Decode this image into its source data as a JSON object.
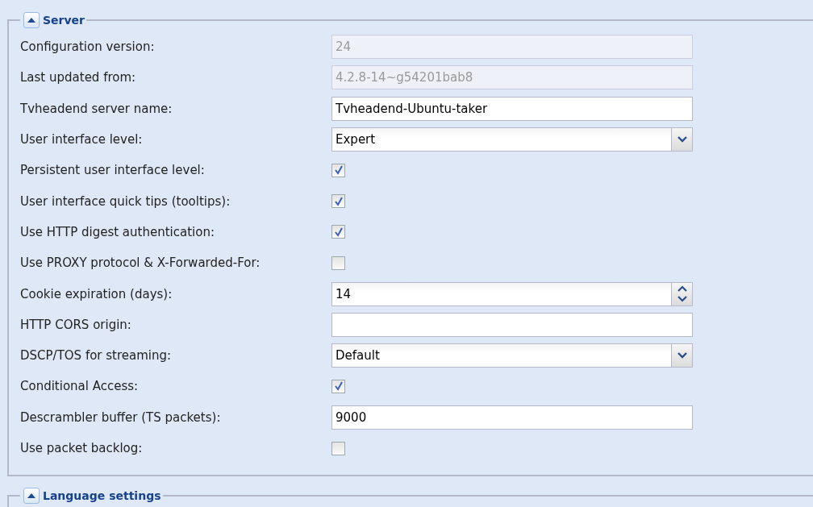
{
  "sections": [
    {
      "title": "Server",
      "expanded": true,
      "fields": [
        {
          "label": "Configuration version:",
          "kind": "text",
          "value": "24",
          "disabled": true
        },
        {
          "label": "Last updated from:",
          "kind": "text",
          "value": "4.2.8-14~g54201bab8",
          "disabled": true
        },
        {
          "label": "Tvheadend server name:",
          "kind": "text",
          "value": "Tvheadend-Ubuntu-taker",
          "disabled": false
        },
        {
          "label": "User interface level:",
          "kind": "select",
          "value": "Expert"
        },
        {
          "label": "Persistent user interface level:",
          "kind": "checkbox",
          "checked": true
        },
        {
          "label": "User interface quick tips (tooltips):",
          "kind": "checkbox",
          "checked": true
        },
        {
          "label": "Use HTTP digest authentication:",
          "kind": "checkbox",
          "checked": true
        },
        {
          "label": "Use PROXY protocol & X-Forwarded-For:",
          "kind": "checkbox",
          "checked": false
        },
        {
          "label": "Cookie expiration (days):",
          "kind": "number",
          "value": "14"
        },
        {
          "label": "HTTP CORS origin:",
          "kind": "text",
          "disabled": false
        },
        {
          "label": "DSCP/TOS for streaming:",
          "kind": "select",
          "value": "Default"
        },
        {
          "label": "Conditional Access:",
          "kind": "checkbox",
          "checked": true
        },
        {
          "label": "Descrambler buffer (TS packets):",
          "kind": "text",
          "value": "9000",
          "disabled": false
        },
        {
          "label": "Use packet backlog:",
          "kind": "checkbox",
          "checked": false
        }
      ]
    },
    {
      "title": "Language settings",
      "expanded": true
    }
  ]
}
